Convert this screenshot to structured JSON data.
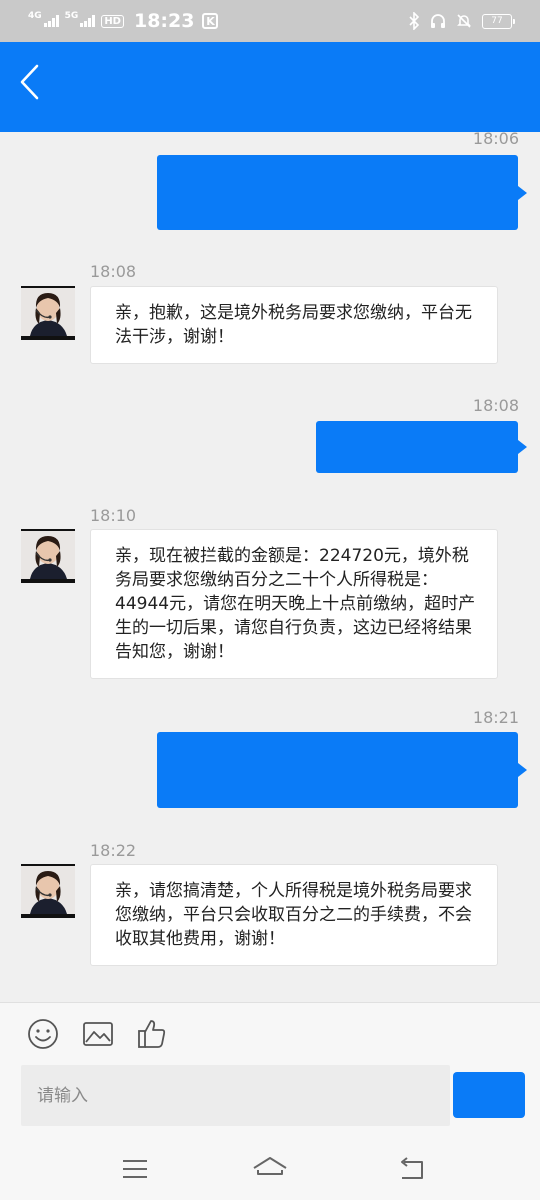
{
  "status_bar": {
    "network_1": "4G",
    "network_2": "5G",
    "hd_badge": "HD",
    "time": "18:23",
    "k_badge": "K",
    "battery": "77",
    "icons": [
      "bluetooth-icon",
      "headphones-icon",
      "bell-muted-icon",
      "battery-icon"
    ]
  },
  "header": {
    "back_icon": "chevron-left-icon",
    "color": "#0a7bf7"
  },
  "chat": {
    "messages": [
      {
        "direction": "outgoing",
        "time": "18:06",
        "text": ""
      },
      {
        "direction": "incoming",
        "time": "18:08",
        "text": "亲，抱歉，这是境外税务局要求您缴纳，平台无法干涉，谢谢！"
      },
      {
        "direction": "outgoing",
        "time": "18:08",
        "text": ""
      },
      {
        "direction": "incoming",
        "time": "18:10",
        "text": "亲，现在被拦截的金额是：224720元，境外税务局要求您缴纳百分之二十个人所得税是：44944元，请您在明天晚上十点前缴纳，超时产生的一切后果，请您自行负责，这边已经将结果告知您，谢谢！"
      },
      {
        "direction": "outgoing",
        "time": "18:21",
        "text": ""
      },
      {
        "direction": "incoming",
        "time": "18:22",
        "text": "亲，请您搞清楚，个人所得税是境外税务局要求您缴纳，平台只会收取百分之二的手续费，不会收取其他费用，谢谢！"
      }
    ]
  },
  "input_bar": {
    "tools": [
      "emoji-icon",
      "image-icon",
      "thumbs-up-icon"
    ],
    "placeholder": "请输入",
    "send_label": ""
  },
  "nav_bar": {
    "buttons": [
      "menu-icon",
      "home-icon",
      "back-icon"
    ]
  },
  "colors": {
    "accent": "#0a7bf7",
    "background": "#f0f0f0",
    "timestamp": "#9a9a9a"
  }
}
